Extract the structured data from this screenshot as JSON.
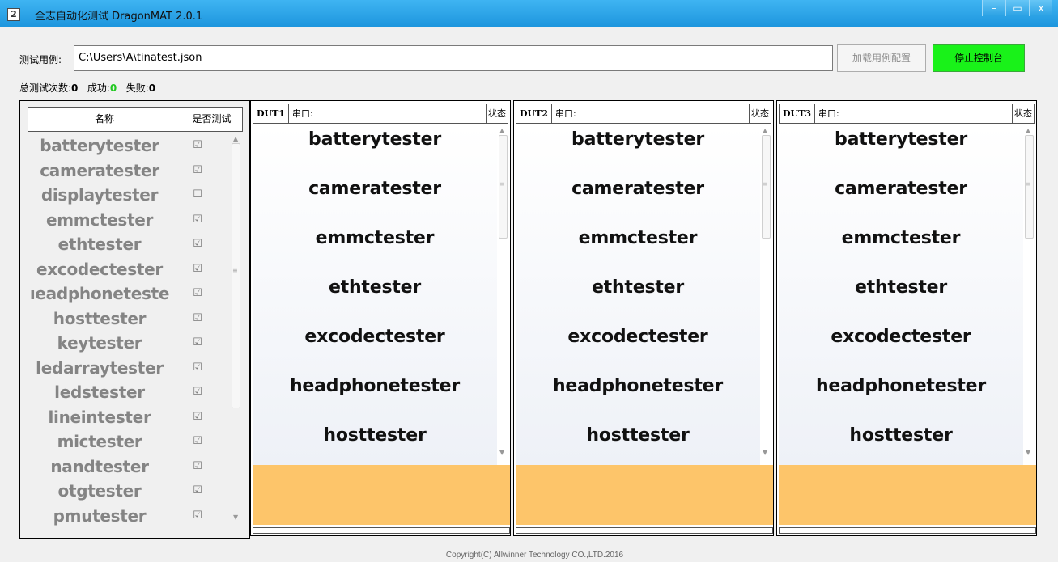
{
  "window": {
    "title": "全志自动化测试 DragonMAT 2.0.1",
    "controls": [
      "–",
      "▭",
      "x"
    ]
  },
  "form": {
    "case_label": "测试用例:",
    "case_path": "C:\\Users\\A\\tinatest.json",
    "load_button": "加载用例配置",
    "stop_button": "停止控制台"
  },
  "stats": {
    "total_label": "总测试次数:",
    "total_value": "0",
    "success_label": "成功:",
    "success_value": "0",
    "fail_label": "失败:",
    "fail_value": "0"
  },
  "case_list": {
    "col_name": "名称",
    "col_test": "是否测试",
    "rows": [
      {
        "name": "batterytester",
        "checked": true
      },
      {
        "name": "cameratester",
        "checked": true
      },
      {
        "name": "displaytester",
        "checked": false
      },
      {
        "name": "emmctester",
        "checked": true
      },
      {
        "name": "ethtester",
        "checked": true
      },
      {
        "name": "excodectester",
        "checked": true
      },
      {
        "name": "ıeadphoneteste",
        "checked": true
      },
      {
        "name": "hosttester",
        "checked": true
      },
      {
        "name": "keytester",
        "checked": true
      },
      {
        "name": "ledarraytester",
        "checked": true
      },
      {
        "name": "ledstester",
        "checked": true
      },
      {
        "name": "lineintester",
        "checked": true
      },
      {
        "name": "mictester",
        "checked": true
      },
      {
        "name": "nandtester",
        "checked": true
      },
      {
        "name": "otgtester",
        "checked": true
      },
      {
        "name": "pmutester",
        "checked": true
      }
    ]
  },
  "duts": [
    {
      "id": "DUT1",
      "port_label": "串口:",
      "status_label": "状态",
      "items": [
        "batterytester",
        "cameratester",
        "emmctester",
        "ethtester",
        "excodectester",
        "headphonetester",
        "hosttester"
      ]
    },
    {
      "id": "DUT2",
      "port_label": "串口:",
      "status_label": "状态",
      "items": [
        "batterytester",
        "cameratester",
        "emmctester",
        "ethtester",
        "excodectester",
        "headphonetester",
        "hosttester"
      ]
    },
    {
      "id": "DUT3",
      "port_label": "串口:",
      "status_label": "状态",
      "items": [
        "batterytester",
        "cameratester",
        "emmctester",
        "ethtester",
        "excodectester",
        "headphonetester",
        "hosttester"
      ]
    }
  ],
  "colors": {
    "titlebar": "#1c95dd",
    "stop_button": "#19f219",
    "success": "#21c821",
    "result_area": "#fdc56a"
  },
  "footer": {
    "copyright": "Copyright(C) Allwinner Technology CO.,LTD.2016"
  }
}
